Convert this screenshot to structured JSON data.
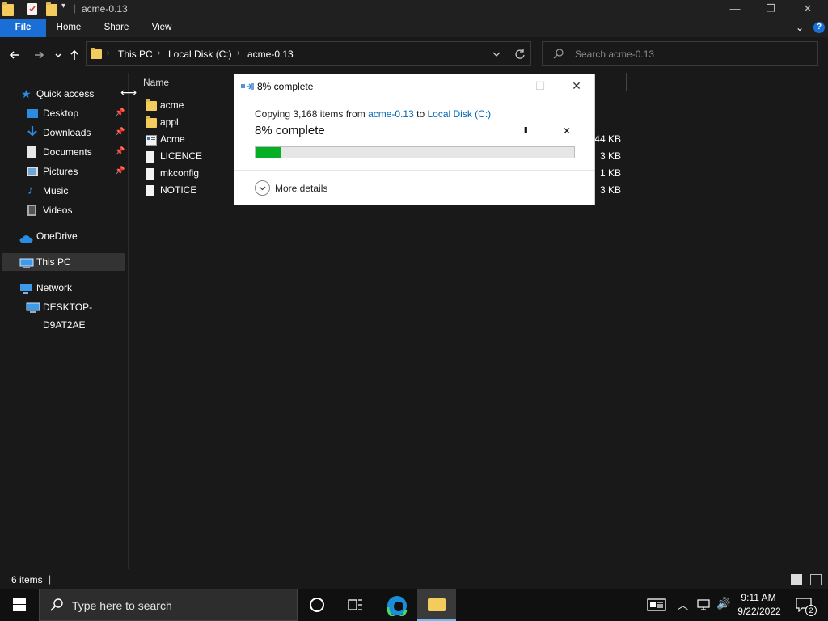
{
  "window": {
    "title": "acme-0.13",
    "min_glyph": "—",
    "max_glyph": "❐",
    "close_glyph": "✕"
  },
  "ribbon": {
    "tabs": [
      "File",
      "Home",
      "Share",
      "View"
    ],
    "accent": "#1a6fd6"
  },
  "address": {
    "crumbs": [
      "This PC",
      "Local Disk (C:)",
      "acme-0.13"
    ],
    "search_placeholder": "Search acme-0.13"
  },
  "nav": {
    "items": [
      {
        "label": "Quick access",
        "icon": "star-icon",
        "pinned": false
      },
      {
        "label": "Desktop",
        "icon": "desktop-icon",
        "pinned": true
      },
      {
        "label": "Downloads",
        "icon": "download-icon",
        "pinned": true
      },
      {
        "label": "Documents",
        "icon": "documents-icon",
        "pinned": true
      },
      {
        "label": "Pictures",
        "icon": "pictures-icon",
        "pinned": true
      },
      {
        "label": "Music",
        "icon": "music-icon",
        "pinned": false
      },
      {
        "label": "Videos",
        "icon": "videos-icon",
        "pinned": false
      },
      {
        "label": "OneDrive",
        "icon": "cloud-icon",
        "pinned": false
      },
      {
        "label": "This PC",
        "icon": "pc-icon",
        "pinned": false
      },
      {
        "label": "Network",
        "icon": "network-icon",
        "pinned": false
      },
      {
        "label": "DESKTOP-D9AT2AE",
        "icon": "computer-icon",
        "pinned": false
      }
    ]
  },
  "filelist": {
    "column_name": "Name",
    "files": [
      {
        "name": "acme",
        "type": "folder",
        "size": ""
      },
      {
        "name": "appl",
        "type": "folder",
        "size": ""
      },
      {
        "name": "Acme",
        "type": "app",
        "size": "344 KB"
      },
      {
        "name": "LICENCE",
        "type": "file",
        "size": "3 KB"
      },
      {
        "name": "mkconfig",
        "type": "file",
        "size": "1 KB"
      },
      {
        "name": "NOTICE",
        "type": "file",
        "size": "3 KB"
      }
    ]
  },
  "status": {
    "item_count": "6 items"
  },
  "dialog": {
    "title": "8% complete",
    "copy_prefix": "Copying 3,168 items from",
    "source": "acme-0.13",
    "to_word": "to",
    "destination": "Local Disk (C:)",
    "percent_text": "8% complete",
    "progress": 0.08,
    "pause_glyph": "II",
    "cancel_glyph": "✕",
    "more_details": "More details",
    "progress_color": "#06b025"
  },
  "taskbar": {
    "search_placeholder": "Type here to search",
    "time": "9:11 AM",
    "date": "9/22/2022",
    "notifications": "2"
  }
}
